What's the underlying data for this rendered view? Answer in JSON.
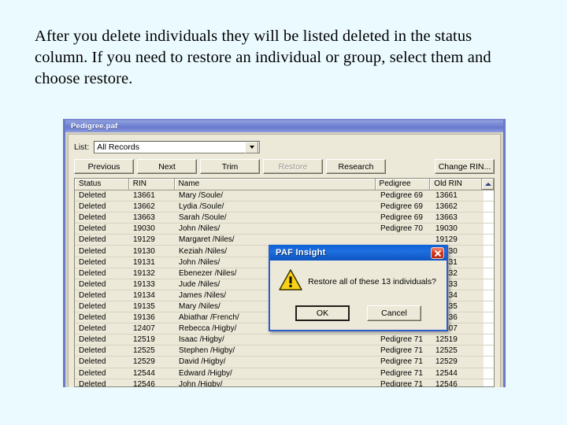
{
  "slide": {
    "caption": "After you delete individuals they will be listed deleted in the status column.  If you need to restore an individual or group, select them and choose restore."
  },
  "window": {
    "title": "Pedigree.paf",
    "list_label": "List:",
    "list_value": "All Records",
    "list_options": [
      "All Records"
    ],
    "buttons": [
      {
        "label": "Previous",
        "disabled": false
      },
      {
        "label": "Next",
        "disabled": false
      },
      {
        "label": "Trim",
        "disabled": false
      },
      {
        "label": "Restore",
        "disabled": true
      },
      {
        "label": "Research",
        "disabled": false
      },
      {
        "label": "Change RIN...",
        "disabled": false
      }
    ]
  },
  "grid": {
    "columns": [
      "Status",
      "RIN",
      "Name",
      "Pedigree",
      "Old RIN"
    ],
    "rows": [
      {
        "status": "Deleted",
        "rin": "13661",
        "name": "Mary /Soule/",
        "pedigree": "Pedigree 69",
        "old_rin": "13661"
      },
      {
        "status": "Deleted",
        "rin": "13662",
        "name": "Lydia /Soule/",
        "pedigree": "Pedigree 69",
        "old_rin": "13662"
      },
      {
        "status": "Deleted",
        "rin": "13663",
        "name": "Sarah /Soule/",
        "pedigree": "Pedigree 69",
        "old_rin": "13663"
      },
      {
        "status": "Deleted",
        "rin": "19030",
        "name": "John /Niles/",
        "pedigree": "Pedigree 70",
        "old_rin": "19030"
      },
      {
        "status": "Deleted",
        "rin": "19129",
        "name": "Margaret /Niles/",
        "pedigree": "",
        "old_rin": "19129"
      },
      {
        "status": "Deleted",
        "rin": "19130",
        "name": "Keziah /Niles/",
        "pedigree": "",
        "old_rin": "19130"
      },
      {
        "status": "Deleted",
        "rin": "19131",
        "name": "John /Niles/",
        "pedigree": "",
        "old_rin": "19131"
      },
      {
        "status": "Deleted",
        "rin": "19132",
        "name": "Ebenezer /Niles/",
        "pedigree": "",
        "old_rin": "19132"
      },
      {
        "status": "Deleted",
        "rin": "19133",
        "name": "Jude /Niles/",
        "pedigree": "",
        "old_rin": "19133"
      },
      {
        "status": "Deleted",
        "rin": "19134",
        "name": "James /Niles/",
        "pedigree": "",
        "old_rin": "19134"
      },
      {
        "status": "Deleted",
        "rin": "19135",
        "name": "Mary /Niles/",
        "pedigree": "",
        "old_rin": "19135"
      },
      {
        "status": "Deleted",
        "rin": "19136",
        "name": "Abiathar /French/",
        "pedigree": "",
        "old_rin": "19136"
      },
      {
        "status": "Deleted",
        "rin": "12407",
        "name": "Rebecca /Higby/",
        "pedigree": "",
        "old_rin": "12407"
      },
      {
        "status": "Deleted",
        "rin": "12519",
        "name": "Isaac /Higby/",
        "pedigree": "Pedigree 71",
        "old_rin": "12519"
      },
      {
        "status": "Deleted",
        "rin": "12525",
        "name": "Stephen /Higby/",
        "pedigree": "Pedigree 71",
        "old_rin": "12525"
      },
      {
        "status": "Deleted",
        "rin": "12529",
        "name": "David /Higby/",
        "pedigree": "Pedigree 71",
        "old_rin": "12529"
      },
      {
        "status": "Deleted",
        "rin": "12544",
        "name": "Edward /Higby/",
        "pedigree": "Pedigree 71",
        "old_rin": "12544"
      },
      {
        "status": "Deleted",
        "rin": "12546",
        "name": "John /Higby/",
        "pedigree": "Pedigree 71",
        "old_rin": "12546"
      }
    ]
  },
  "dialog": {
    "title": "PAF Insight",
    "message": "Restore all of these 13 individuals?",
    "ok_label": "OK",
    "cancel_label": "Cancel",
    "icon": "warning-icon"
  },
  "colors": {
    "slide_background": "#eafaff",
    "window_border": "#6a79c8",
    "dialog_title": "#0d55c0",
    "warning_yellow": "#f5cb1e",
    "close_red": "#d83a1c"
  }
}
